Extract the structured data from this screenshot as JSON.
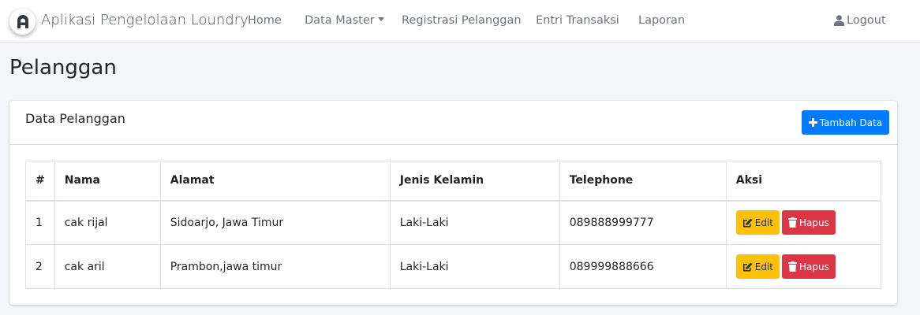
{
  "navbar": {
    "brand": "Aplikasi Pengelolaan Loundry",
    "links": [
      "Home",
      "Data Master",
      "Registrasi Pelanggan",
      "Entri Transaksi",
      "Laporan"
    ],
    "logout": "Logout"
  },
  "page": {
    "title": "Pelanggan"
  },
  "card": {
    "title": "Data Pelanggan",
    "add_button": "Tambah Data"
  },
  "table": {
    "headers": [
      "#",
      "Nama",
      "Alamat",
      "Jenis Kelamin",
      "Telephone",
      "Aksi"
    ],
    "rows": [
      {
        "no": "1",
        "nama": "cak rijal",
        "alamat": "Sidoarjo, Jawa Timur",
        "jenis_kelamin": "Laki-Laki",
        "telephone": "089888999777"
      },
      {
        "no": "2",
        "nama": "cak aril",
        "alamat": "Prambon,jawa timur",
        "jenis_kelamin": "Laki-Laki",
        "telephone": "089999888666"
      }
    ],
    "edit_label": "Edit",
    "delete_label": "Hapus"
  },
  "colors": {
    "primary": "#007bff",
    "warning": "#ffc107",
    "danger": "#dc3545",
    "background": "#f4f6f9"
  },
  "icons": [
    "brand-logo-icon",
    "user-icon",
    "plus-icon",
    "edit-icon",
    "trash-icon"
  ]
}
